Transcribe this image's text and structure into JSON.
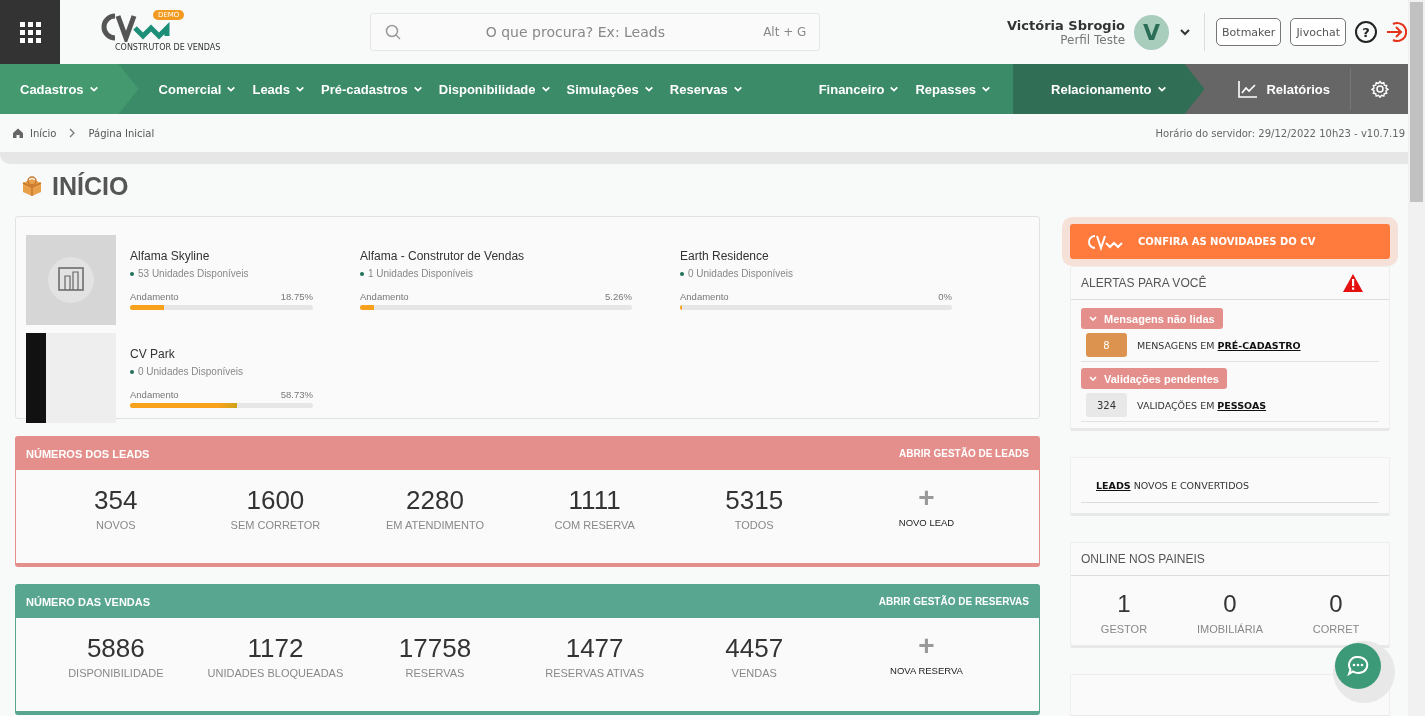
{
  "header": {
    "logo": {
      "badge": "DEMO",
      "tagline": "CONSTRUTOR DE VENDAS"
    },
    "search": {
      "placeholder": "O que procura? Ex: Leads",
      "shortcut": "Alt + G"
    },
    "user": {
      "name": "Victória Sbrogio",
      "profile": "Perfil Teste",
      "initial": "V"
    },
    "buttons": [
      "Botmaker",
      "Jivochat"
    ],
    "help": "?"
  },
  "nav": {
    "groups": [
      {
        "kind": "light",
        "items": [
          "Cadastros"
        ]
      },
      {
        "kind": "plain",
        "items": [
          "Comercial",
          "Leads",
          "Pré-cadastros",
          "Disponibilidade",
          "Simulações",
          "Reservas"
        ]
      },
      {
        "kind": "plain",
        "items": [
          "Financeiro",
          "Repasses"
        ]
      },
      {
        "kind": "dark",
        "items": [
          "Relacionamento"
        ]
      }
    ],
    "reports": "Relatórios"
  },
  "breadcrumb": {
    "items": [
      "Início",
      "Página Inicial"
    ],
    "server_time": "Horário do servidor: 29/12/2022 10h23 - v10.7.19"
  },
  "page_title": "INÍCIO",
  "projects": [
    {
      "name": "Alfama Skyline",
      "units": "53 Unidades Disponíveis",
      "progress_label": "Andamento",
      "percent": "18.75%",
      "level": 0.1875,
      "kind": "logo"
    },
    {
      "name": "Alfama - Construtor de Vendas",
      "units": "1 Unidades Disponíveis",
      "progress_label": "Andamento",
      "percent": "5.26%",
      "level": 0.0526,
      "kind": "blank"
    },
    {
      "name": "Earth Residence",
      "units": "0 Unidades Disponíveis",
      "progress_label": "Andamento",
      "percent": "0%",
      "level": 0,
      "kind": "blank"
    },
    {
      "name": "CV Park",
      "units": "0 Unidades Disponíveis",
      "progress_label": "Andamento",
      "percent": "58.73%",
      "level": 0.5873,
      "kind": "photo"
    }
  ],
  "stat_panels": [
    {
      "title": "NÚMEROS DOS LEADS",
      "link": "ABRIR GESTÃO DE LEADS",
      "color": "#e48f8b",
      "stats": [
        {
          "value": "354",
          "label": "NOVOS"
        },
        {
          "value": "1600",
          "label": "SEM CORRETOR"
        },
        {
          "value": "2280",
          "label": "EM ATENDIMENTO"
        },
        {
          "value": "1111",
          "label": "COM RESERVA"
        },
        {
          "value": "5315",
          "label": "TODOS"
        }
      ],
      "action": {
        "icon": "+",
        "label": "NOVO LEAD"
      }
    },
    {
      "title": "NÚMERO DAS VENDAS",
      "link": "ABRIR GESTÃO DE RESERVAS",
      "color": "#58a690",
      "stats": [
        {
          "value": "5886",
          "label": "DISPONIBILIDADE"
        },
        {
          "value": "1172",
          "label": "UNIDADES BLOQUEADAS"
        },
        {
          "value": "17758",
          "label": "RESERVAS"
        },
        {
          "value": "1477",
          "label": "RESERVAS ATIVAS"
        },
        {
          "value": "4457",
          "label": "VENDAS"
        }
      ],
      "action": {
        "icon": "+",
        "label": "NOVA RESERVA"
      }
    }
  ],
  "promo": {
    "label": "CONFIRA AS NOVIDADES DO CV"
  },
  "alerts": {
    "title": "ALERTAS PARA VOCÊ",
    "groups": [
      {
        "label": "Mensagens não lidas",
        "count": "8",
        "color": "#dc9350",
        "text": "MENSAGENS EM ",
        "link": "PRÉ-CADASTRO"
      },
      {
        "label": "Validações pendentes",
        "count": "324",
        "color": "#e8e8e8",
        "text": "VALIDAÇÕES EM ",
        "link": "PESSOAS"
      }
    ]
  },
  "leads_box": {
    "link": "LEADS",
    "text": " NOVOS E CONVERTIDOS"
  },
  "online": {
    "title": "ONLINE NOS PAINEIS",
    "stats": [
      {
        "value": "1",
        "label": "GESTOR"
      },
      {
        "value": "0",
        "label": "IMOBILIÁRIA"
      },
      {
        "value": "0",
        "label": "CORRET"
      }
    ]
  }
}
